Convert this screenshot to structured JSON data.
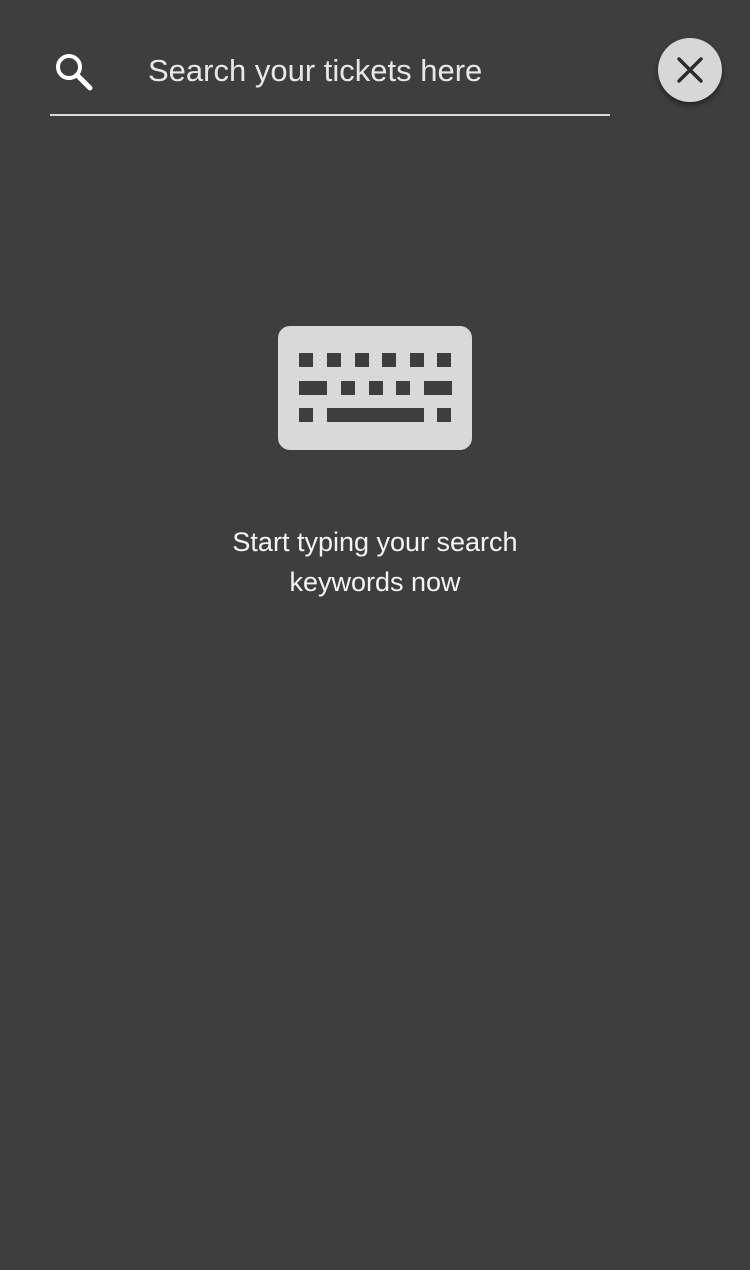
{
  "search": {
    "placeholder": "Search your tickets here",
    "value": "",
    "icon": "search-icon"
  },
  "close_button": {
    "icon": "close-icon"
  },
  "empty_state": {
    "icon": "keyboard-icon",
    "message": "Start typing your search keywords now"
  },
  "colors": {
    "background": "#3e3e3e",
    "foreground": "#f2f2f2",
    "icon_fill": "#d9d9d9",
    "divider": "#d9d9d9"
  }
}
